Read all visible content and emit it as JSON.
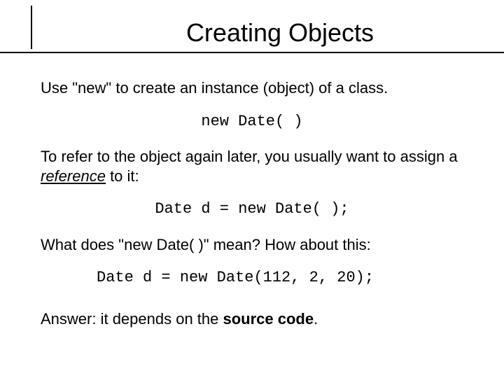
{
  "title": "Creating Objects",
  "p1": "Use \"new\" to create an instance (object) of a class.",
  "code1": "new Date( )",
  "p2_a": "To refer to the object again later, you usually want to assign a ",
  "p2_ref": "reference",
  "p2_b": " to it:",
  "code2": "Date d = new Date( );",
  "p3": "What does \"new Date(  )\" mean?   How about this:",
  "code3": "Date d = new Date(112, 2, 20);",
  "ans_a": "Answer:  it depends on the ",
  "ans_b": "source code",
  "ans_c": "."
}
